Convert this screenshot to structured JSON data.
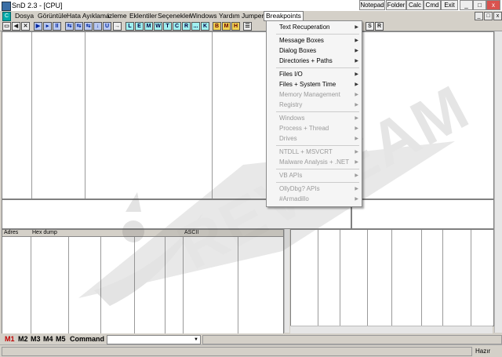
{
  "window": {
    "title": "SnD 2.3 - [CPU]",
    "buttons": [
      "Notepad",
      "Folder",
      "Calc",
      "Cmd",
      "Exit"
    ]
  },
  "menubar": {
    "items": [
      "Dosya",
      "Görüntüle",
      "Hata Ayıklama",
      "izleme",
      "Eklentiler",
      "Seçenekler",
      "Windows",
      "Yardım",
      "Jumper",
      "Breakpoints"
    ],
    "active": "Breakpoints"
  },
  "toolbar": {
    "nav_buttons": [
      "▶",
      "▸",
      "II",
      "⇆",
      "⇆",
      "⇆",
      "↓",
      "U"
    ],
    "letter_buttons": [
      "L",
      "E",
      "M",
      "W",
      "T",
      "C",
      "R",
      "...",
      "K"
    ],
    "extra_buttons": [
      "B",
      "M",
      "H"
    ],
    "right_buttons": [
      "S",
      "R"
    ]
  },
  "dump_pane": {
    "headers": [
      "Adres",
      "Hex dump",
      "ASCII"
    ]
  },
  "breakpoints_menu": {
    "items": [
      {
        "label": "Text Recuperation",
        "enabled": true
      },
      {
        "label": "Message Boxes",
        "enabled": true
      },
      {
        "label": "Dialog Boxes",
        "enabled": true
      },
      {
        "label": "Directories + Paths",
        "enabled": true
      },
      {
        "label": "Files I/O",
        "enabled": true
      },
      {
        "label": "Files + System Time",
        "enabled": true
      },
      {
        "label": "Memory Management",
        "enabled": false
      },
      {
        "label": "Registry",
        "enabled": false
      },
      {
        "label": "Windows",
        "enabled": false
      },
      {
        "label": "Process + Thread",
        "enabled": false
      },
      {
        "label": "Drives",
        "enabled": false
      },
      {
        "label": "NTDLL + MSVCRT",
        "enabled": false
      },
      {
        "label": "Malware Analysis + .NET",
        "enabled": false
      },
      {
        "label": "VB APIs",
        "enabled": false
      },
      {
        "label": "OllyDbg? APIs",
        "enabled": false
      },
      {
        "label": "#Armadillo",
        "enabled": false
      }
    ]
  },
  "command_bar": {
    "memory_buttons": [
      "M1",
      "M2",
      "M3",
      "M4",
      "M5"
    ],
    "command_label": "Command :",
    "command_value": ""
  },
  "statusbar": {
    "state": "Hazır"
  },
  "watermark": {
    "text": "REVTEAM"
  },
  "colors": {
    "menu_active_border": "#7a7a7a",
    "m1_color": "#c00000"
  }
}
